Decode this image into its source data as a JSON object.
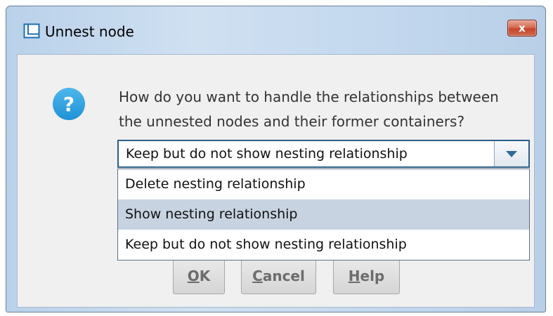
{
  "window": {
    "title": "Unnest node",
    "close_label": "x"
  },
  "message": {
    "line1": "How do you want to handle the relationships between",
    "line2": "the unnested nodes and their former containers?"
  },
  "combo": {
    "selected": "Keep but do not show nesting relationship"
  },
  "options": [
    "Delete nesting relationship",
    "Show nesting relationship",
    "Keep but do not show nesting relationship"
  ],
  "buttons": {
    "ok": {
      "mnemonic": "O",
      "rest": "K"
    },
    "cancel": {
      "mnemonic": "C",
      "rest": "ancel"
    },
    "help": {
      "mnemonic": "H",
      "rest": "elp"
    }
  },
  "icons": {
    "question": "?",
    "app": "window-icon"
  },
  "colors": {
    "accent": "#2b5f87",
    "highlight": "#c7d3e1",
    "question_icon": "#1d93d6",
    "close": "#c7462a"
  }
}
